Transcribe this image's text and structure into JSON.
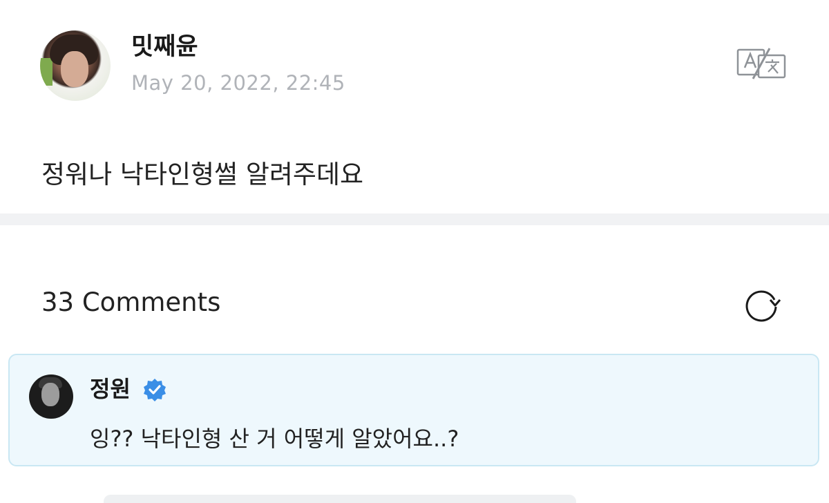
{
  "post": {
    "author": "밋째윤",
    "date": "May 20, 2022, 22:45",
    "body": "정워나 낙타인형썰 알려주데요",
    "translate_icon": "translate-icon"
  },
  "comments": {
    "count_label": "33 Comments",
    "refresh_icon": "refresh-icon",
    "items": [
      {
        "author": "정원",
        "verified": true,
        "text": "잉?? 낙타인형 산 거 어떻게 알았어요..?"
      }
    ]
  },
  "colors": {
    "verified": "#3a8ee6",
    "card_bg": "#eef8fd",
    "card_border": "#c9e7f3",
    "date_text": "#b0b3b8"
  }
}
